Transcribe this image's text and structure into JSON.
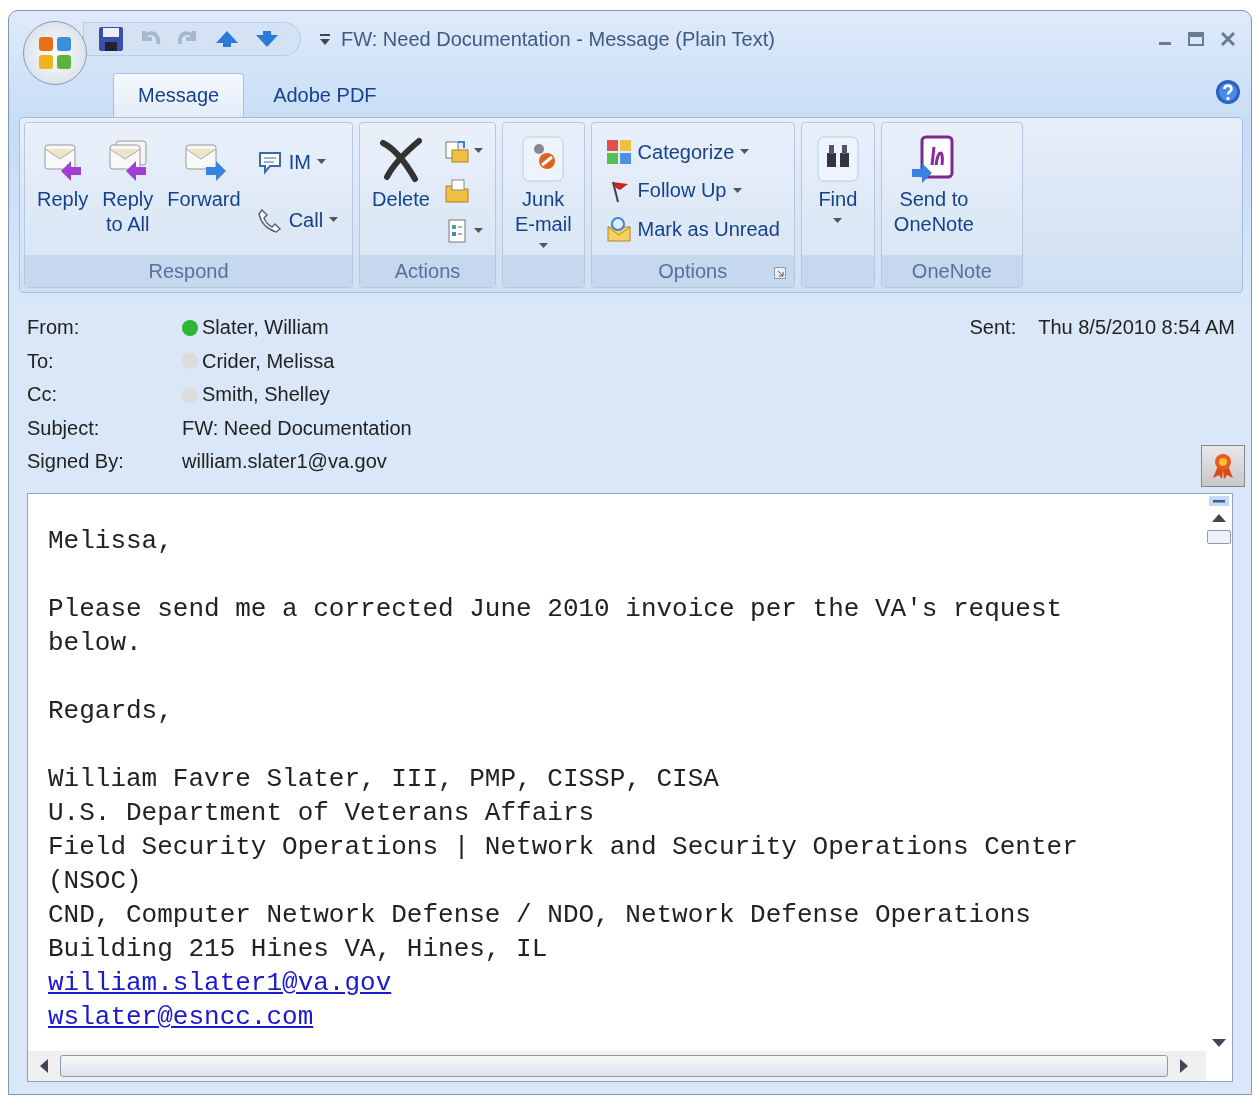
{
  "window": {
    "title": "FW: Need Documentation - Message (Plain Text)"
  },
  "tabs": [
    {
      "label": "Message",
      "selected": true
    },
    {
      "label": "Adobe PDF",
      "selected": false
    }
  ],
  "ribbon_groups": [
    {
      "label": "Respond",
      "columns": [
        {
          "kind": "large",
          "items": [
            {
              "label": "Reply",
              "dropdown": false
            }
          ]
        },
        {
          "kind": "large",
          "items": [
            {
              "label": "Reply\nto All",
              "dropdown": false
            }
          ]
        },
        {
          "kind": "large",
          "items": [
            {
              "label": "Forward",
              "dropdown": false
            }
          ]
        },
        {
          "kind": "small",
          "items": [
            {
              "label": "IM",
              "dropdown": true
            },
            {
              "label": "Call",
              "dropdown": true
            }
          ]
        }
      ]
    },
    {
      "label": "Actions",
      "columns": [
        {
          "kind": "large",
          "items": [
            {
              "label": "Delete",
              "dropdown": false
            }
          ]
        },
        {
          "kind": "icons",
          "items": [
            {
              "dropdown": true
            },
            {
              "dropdown": false
            },
            {
              "dropdown": true
            }
          ]
        }
      ]
    },
    {
      "columns": [
        {
          "kind": "large",
          "items": [
            {
              "label": "Junk\nE-mail",
              "dropdown": true
            }
          ]
        }
      ]
    },
    {
      "label": "Options",
      "launcher": true,
      "columns": [
        {
          "kind": "small",
          "items": [
            {
              "label": "Categorize",
              "dropdown": true
            },
            {
              "label": "Follow Up",
              "dropdown": true
            },
            {
              "label": "Mark as Unread",
              "dropdown": false
            }
          ]
        }
      ]
    },
    {
      "columns": [
        {
          "kind": "large",
          "items": [
            {
              "label": "Find",
              "dropdown": true
            }
          ]
        }
      ]
    },
    {
      "label": "OneNote",
      "columns": [
        {
          "kind": "large",
          "items": [
            {
              "label": "Send to\nOneNote",
              "dropdown": false
            }
          ]
        }
      ]
    }
  ],
  "header": {
    "fields": [
      {
        "label": "From:",
        "value": "Slater, William",
        "color": "#2fb52f"
      },
      {
        "label": "To:",
        "value": "Crider, Melissa",
        "color": "#dcdcdc"
      },
      {
        "label": "Cc:",
        "value": "Smith, Shelley",
        "color": "#dcdcdc"
      },
      {
        "label": "Subject:",
        "value": "FW: Need Documentation"
      },
      {
        "label": "Signed By:",
        "value": "william.slater1@va.gov"
      }
    ],
    "sent": {
      "label": "Sent:",
      "value": "Thu 8/5/2010 8:54 AM"
    }
  },
  "body": {
    "paragraphs": [
      [
        {
          "kind": "text",
          "text": "Melissa,"
        }
      ],
      [
        {
          "kind": "text",
          "text": "Please send me a corrected June 2010 invoice per the VA's request below."
        }
      ],
      [
        {
          "kind": "text",
          "text": "Regards,"
        }
      ],
      [
        {
          "kind": "text",
          "text": "William Favre Slater, III, PMP, CISSP, CISA"
        },
        {
          "kind": "text",
          "text": "U.S. Department of Veterans Affairs"
        },
        {
          "kind": "text",
          "text": "Field Security Operations | Network and Security Operations Center (NSOC)"
        },
        {
          "kind": "text",
          "text": "CND, Computer Network Defense / NDO, Network Defense Operations"
        },
        {
          "kind": "text",
          "text": "Building 215 Hines VA, Hines, IL"
        },
        {
          "kind": "link",
          "text": "william.slater1@va.gov"
        },
        {
          "kind": "link",
          "text": "wslater@esncc.com"
        }
      ]
    ]
  }
}
